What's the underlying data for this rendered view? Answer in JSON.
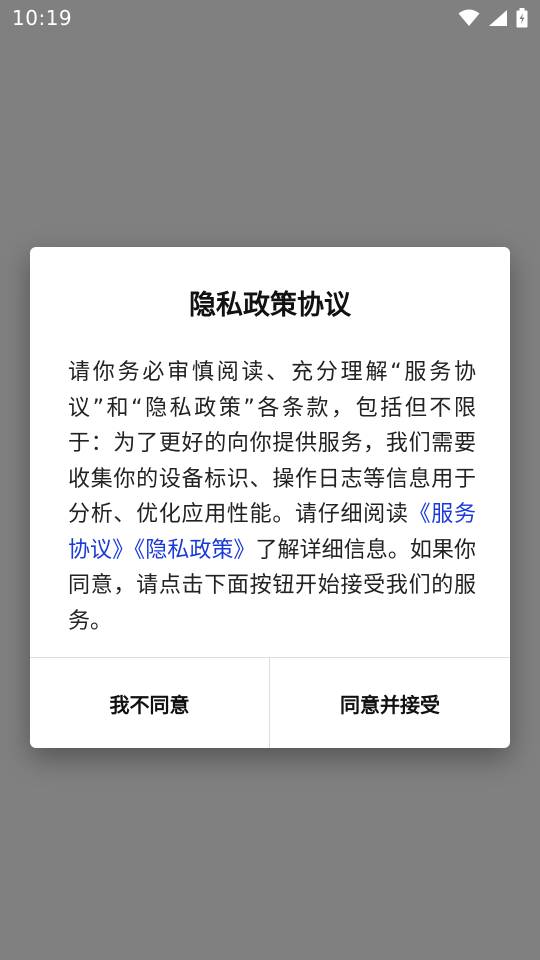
{
  "status_bar": {
    "time": "10:19",
    "icons": [
      "wifi-icon",
      "signal-icon",
      "battery-charging-icon"
    ]
  },
  "dialog": {
    "title": "隐私政策协议",
    "body_before": "请你务必审慎阅读、充分理解“服务协议”和“隐私政策”各条款，包括但不限于：为了更好的向你提供服务，我们需要收集你的设备标识、操作日志等信息用于分析、优化应用性能。请仔细阅读",
    "service_agreement_link": "《服务协议》",
    "privacy_policy_link": "《隐私政策》",
    "body_after": "了解详细信息。如果你同意，请点击下面按钮开始接受我们的服务。",
    "decline_label": "我不同意",
    "accept_label": "同意并接受"
  },
  "colors": {
    "backdrop": "#808080",
    "link": "#1a3ad8",
    "dialog_bg": "#ffffff"
  }
}
